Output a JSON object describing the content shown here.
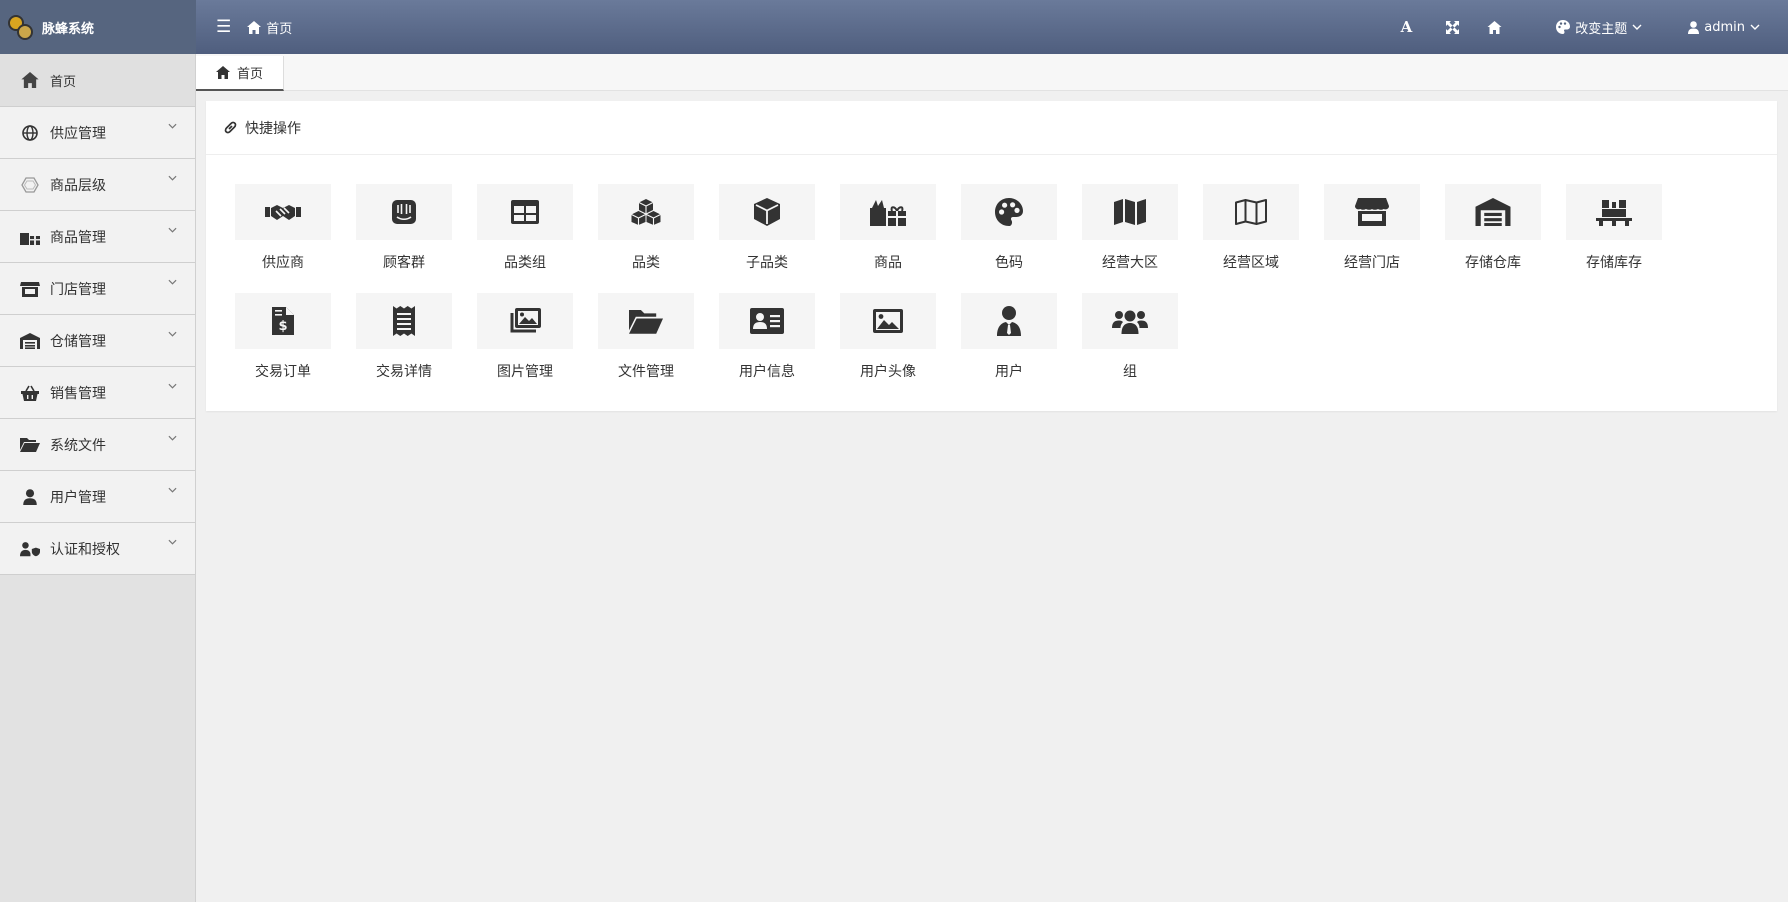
{
  "brand": {
    "name": "脉蜂系统"
  },
  "topbar": {
    "home_label": "首页",
    "font_button": "A",
    "theme_label": "改变主题",
    "user_label": "admin"
  },
  "sidebar": {
    "items": [
      {
        "label": "首页",
        "icon": "home-icon"
      },
      {
        "label": "供应管理",
        "icon": "globe-icon"
      },
      {
        "label": "商品层级",
        "icon": "hexagon-icon"
      },
      {
        "label": "商品管理",
        "icon": "gifts-icon"
      },
      {
        "label": "门店管理",
        "icon": "store-icon"
      },
      {
        "label": "仓储管理",
        "icon": "warehouse-icon"
      },
      {
        "label": "销售管理",
        "icon": "basket-icon"
      },
      {
        "label": "系统文件",
        "icon": "folder-open-icon"
      },
      {
        "label": "用户管理",
        "icon": "user-icon"
      },
      {
        "label": "认证和授权",
        "icon": "user-shield-icon"
      }
    ]
  },
  "tabs": [
    {
      "label": "首页"
    }
  ],
  "panel": {
    "title": "快捷操作",
    "tiles": [
      {
        "label": "供应商",
        "icon": "handshake-icon"
      },
      {
        "label": "顾客群",
        "icon": "intercom-icon"
      },
      {
        "label": "品类组",
        "icon": "table-icon"
      },
      {
        "label": "品类",
        "icon": "cubes-icon"
      },
      {
        "label": "子品类",
        "icon": "cube-icon"
      },
      {
        "label": "商品",
        "icon": "gifts-icon"
      },
      {
        "label": "色码",
        "icon": "palette-icon"
      },
      {
        "label": "经营大区",
        "icon": "map-icon"
      },
      {
        "label": "经营区域",
        "icon": "map-outline-icon"
      },
      {
        "label": "经营门店",
        "icon": "store-icon"
      },
      {
        "label": "存储仓库",
        "icon": "warehouse-icon"
      },
      {
        "label": "存储库存",
        "icon": "pallet-icon"
      },
      {
        "label": "交易订单",
        "icon": "invoice-dollar-icon"
      },
      {
        "label": "交易详情",
        "icon": "receipt-icon"
      },
      {
        "label": "图片管理",
        "icon": "images-icon"
      },
      {
        "label": "文件管理",
        "icon": "folder-open-icon"
      },
      {
        "label": "用户信息",
        "icon": "id-card-icon"
      },
      {
        "label": "用户头像",
        "icon": "image-icon"
      },
      {
        "label": "用户",
        "icon": "user-tie-icon"
      },
      {
        "label": "组",
        "icon": "users-icon"
      }
    ]
  }
}
